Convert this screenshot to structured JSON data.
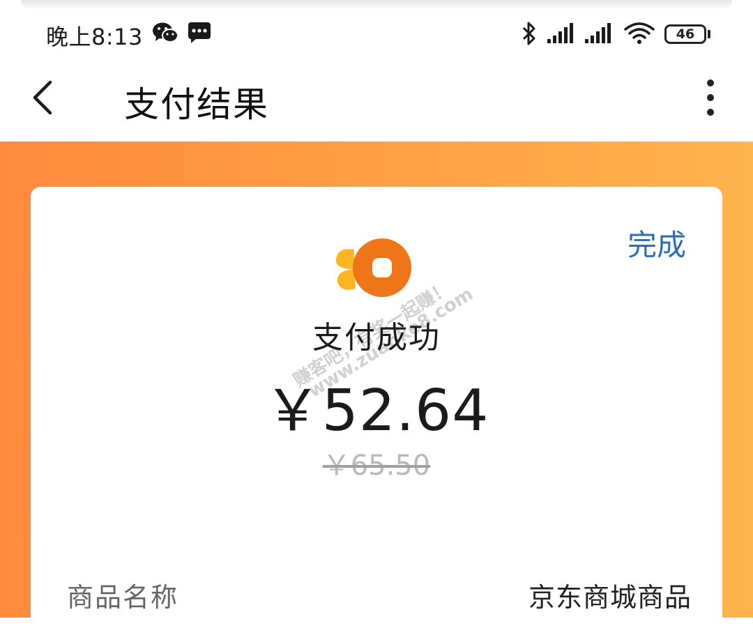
{
  "status_bar": {
    "time": "晚上8:13",
    "battery": "46",
    "icons": [
      "wechat-icon",
      "message-icon",
      "bluetooth-icon",
      "signal-icon",
      "signal-icon",
      "wifi-icon",
      "battery-icon"
    ]
  },
  "nav": {
    "back_icon": "back-arrow-icon",
    "title": "支付结果",
    "more_icon": "more-vertical-icon"
  },
  "result": {
    "done_label": "完成",
    "status_text": "支付成功",
    "amount": "￥52.64",
    "original_amount": "￥65.50"
  },
  "details": [
    {
      "label": "商品名称",
      "value": "京东商城商品"
    }
  ],
  "watermark": {
    "line1": "赚客吧，有奖一起赚！",
    "line2": "www.zuanke8.com"
  },
  "colors": {
    "background_gradient_start": "#ff8a3d",
    "background_gradient_end": "#ffb44e",
    "done_link": "#2a6fb5",
    "logo_orange": "#ee7518",
    "logo_yellow": "#ffb521"
  }
}
